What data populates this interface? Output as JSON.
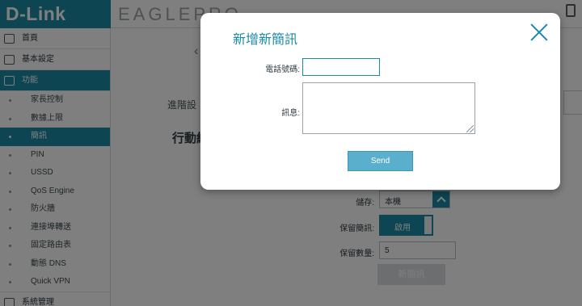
{
  "header": {
    "brand": "D-Link",
    "product": "EAGLEPRO"
  },
  "sidebar": {
    "items": [
      {
        "label": "首頁"
      },
      {
        "label": "基本設定"
      },
      {
        "label": "功能"
      }
    ],
    "sub_items": [
      {
        "label": "家長控制"
      },
      {
        "label": "數據上限"
      },
      {
        "label": "簡訊"
      },
      {
        "label": "PIN"
      },
      {
        "label": "USSD"
      },
      {
        "label": "QoS Engine"
      },
      {
        "label": "防火牆"
      },
      {
        "label": "連接埠轉送"
      },
      {
        "label": "固定路由表"
      },
      {
        "label": "動態 DNS"
      },
      {
        "label": "Quick VPN"
      }
    ],
    "bottom_item": {
      "label": "系統管理"
    }
  },
  "content": {
    "section_label": "進階設",
    "heading": "行動網",
    "storage": {
      "label": "儲存:",
      "value": "本機"
    },
    "keep_messages": {
      "label": "保留簡訊:",
      "toggle_label": "啟用"
    },
    "keep_count": {
      "label": "保留數量:",
      "value": "5"
    },
    "new_sms_button": "新簡訊"
  },
  "dialog": {
    "title": "新增新簡訊",
    "phone_label": "電話號碼:",
    "phone_value": "",
    "message_label": "訊息:",
    "message_value": "",
    "send_button": "Send"
  }
}
